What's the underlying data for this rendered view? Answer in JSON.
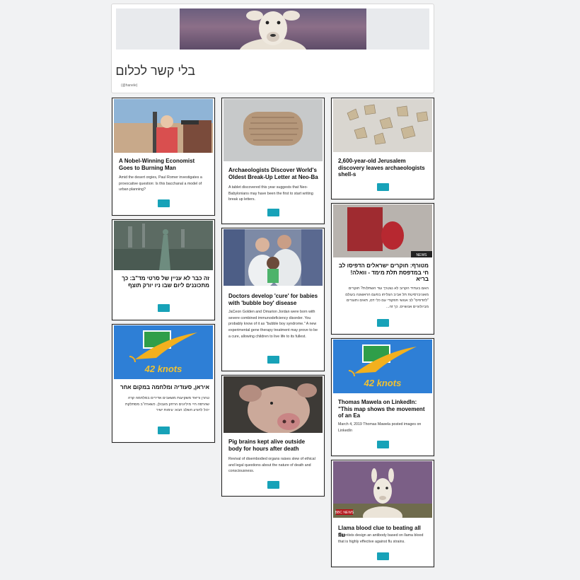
{
  "board": {
    "title": "בלי קשר לכלום",
    "handle": "(@hanele)"
  },
  "button_icon": "",
  "cards": [
    {
      "title": "A Nobel-Winning Economist Goes to Burning Man",
      "desc": "Amid the desert orgies, Paul Romer investigates a provocative question: Is this bacchanal a model of urban planning?"
    },
    {
      "title": "זה כבר לא עניין של סרטי מד\"ב: כך מתכוננים ליום שבו ניו יורק תוצף",
      "desc": ""
    },
    {
      "title": "איראן, סעודיה ומלחמה במקום אחר",
      "desc": "טהרן וריאד משקיעות משאבים אדירים במלחמה קרה שהרסה חיי מיליונים הרחק מגבולן. כשארה\"ב מסתלקת יכול להגיע השלב הבא: עימות ישיר",
      "logo_text": "42 knots"
    },
    {
      "title": "Archaeologists Discover World's Oldest Break-Up Letter at Neo-Ba",
      "desc": "A tablet discovered this year suggests that Neo-Babylonians may have been the first to start writing break up letters."
    },
    {
      "title": "Doctors develop 'cure' for babies with 'bubble boy' disease",
      "desc": "JaCeon Golden and Omarion Jordan were born with severe combined immunodeficiency disorder. You probably know of it as \"bubble boy syndrome.\" A new experimental gene therapy treatment may prove to be a cure, allowing children to live life to its fullest."
    },
    {
      "title": "Pig brains kept alive outside body for hours after death",
      "desc": "Revival of disembodied organs raises slew of ethical and legal questions about the nature of death and consciousness."
    },
    {
      "title": "2,600-year-old Jerusalem discovery leaves archaeologists shell-s",
      "desc": ""
    },
    {
      "title": "מטורף: חוקרים ישראלים הדפיסו לב חי במדפסת תלת מימד - וואלה! בריא",
      "desc": "האם בעתיד הקרוב לא נצטרך עוד השתלות? חוקרים מאוניברסיטת תל אביב הצליחו בפעם הראשונה בעולם \"להדפיס\" לב אנושי תפקודי עם כלי דם, תאים ותוצרים מביולוגיים אנושיים. כך זה...",
      "image_label": "NEWS"
    },
    {
      "title": "Thomas Mawela on LinkedIn: \"This map shows the movement of an Ea",
      "desc": "March 4, 2019 Thomas Mawela posted images on LinkedIn",
      "logo_text": "42 knots"
    },
    {
      "title": "Llama blood clue to beating all flu",
      "desc": "Scientists design an antibody based on llama blood that is highly effective against flu strains.",
      "image_label": "BBC NEWS"
    }
  ]
}
